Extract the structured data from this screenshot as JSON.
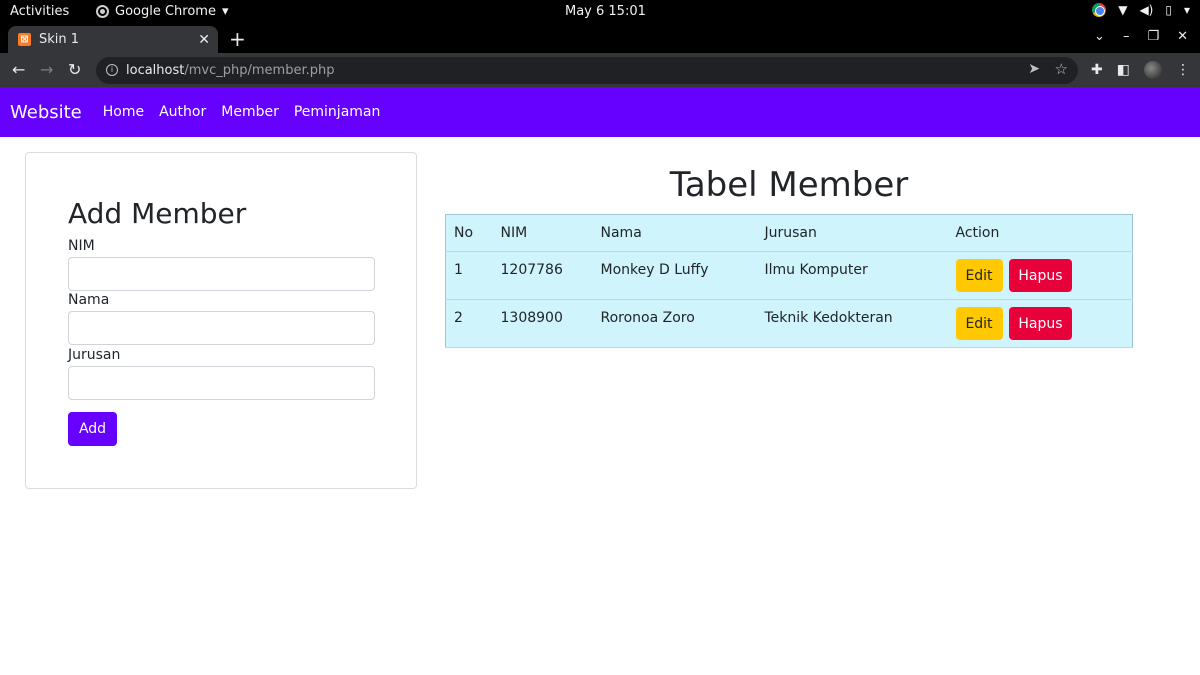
{
  "os_bar": {
    "activities": "Activities",
    "app_name": "Google Chrome",
    "clock": "May 6  15:01"
  },
  "browser": {
    "tab_title": "Skin 1",
    "url_host": "localhost",
    "url_path": "/mvc_php/member.php"
  },
  "navbar": {
    "brand": "Website",
    "links": [
      "Home",
      "Author",
      "Member",
      "Peminjaman"
    ]
  },
  "form": {
    "title": "Add Member",
    "nim_label": "NIM",
    "nama_label": "Nama",
    "jurusan_label": "Jurusan",
    "nim_value": "",
    "nama_value": "",
    "jurusan_value": "",
    "submit_label": "Add"
  },
  "table": {
    "title": "Tabel Member",
    "headers": [
      "No",
      "NIM",
      "Nama",
      "Jurusan",
      "Action"
    ],
    "rows": [
      {
        "no": "1",
        "nim": "1207786",
        "nama": "Monkey D Luffy",
        "jurusan": "Ilmu Komputer"
      },
      {
        "no": "2",
        "nim": "1308900",
        "nama": "Roronoa Zoro",
        "jurusan": "Teknik Kedokteran"
      }
    ],
    "edit_label": "Edit",
    "delete_label": "Hapus"
  },
  "colors": {
    "navbar": "#6600ff",
    "table_bg": "#cff4fc",
    "edit_button": "#ffc800",
    "delete_button": "#e8003a"
  }
}
